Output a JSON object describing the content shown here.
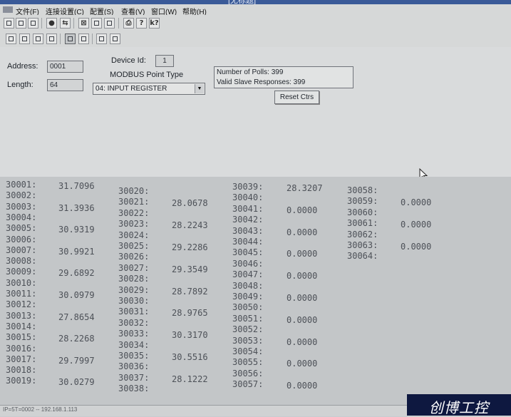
{
  "title": "[无标题]",
  "menu": [
    "文件(F)",
    "连接设置(C)",
    "配置(S)",
    "查看(V)",
    "窗口(W)",
    "帮助(H)"
  ],
  "form": {
    "address_label": "Address:",
    "address_value": "0001",
    "length_label": "Length:",
    "length_value": "64",
    "device_id_label": "Device Id:",
    "device_id_value": "1",
    "point_type_label": "MODBUS Point Type",
    "point_type_value": "04: INPUT REGISTER"
  },
  "stats": {
    "polls": "Number of Polls: 399",
    "responses": "Valid Slave Responses: 399"
  },
  "reset_button": "Reset Ctrs",
  "registers": [
    {
      "col": [
        [
          "30001:",
          "31.7096"
        ],
        [
          "30002:",
          ""
        ],
        [
          "30003:",
          "31.3936"
        ],
        [
          "30004:",
          ""
        ],
        [
          "30005:",
          "30.9319"
        ],
        [
          "30006:",
          ""
        ],
        [
          "30007:",
          "30.9921"
        ],
        [
          "30008:",
          ""
        ],
        [
          "30009:",
          "29.6892"
        ],
        [
          "30010:",
          ""
        ],
        [
          "30011:",
          "30.0979"
        ],
        [
          "30012:",
          ""
        ],
        [
          "30013:",
          "27.8654"
        ],
        [
          "30014:",
          ""
        ],
        [
          "30015:",
          "28.2268"
        ],
        [
          "30016:",
          ""
        ],
        [
          "30017:",
          "29.7997"
        ],
        [
          "30018:",
          ""
        ],
        [
          "30019:",
          "30.0279"
        ]
      ]
    },
    {
      "col": [
        [
          "30020:",
          ""
        ],
        [
          "30021:",
          "28.0678"
        ],
        [
          "30022:",
          ""
        ],
        [
          "30023:",
          "28.2243"
        ],
        [
          "30024:",
          ""
        ],
        [
          "30025:",
          "29.2286"
        ],
        [
          "30026:",
          ""
        ],
        [
          "30027:",
          "29.3549"
        ],
        [
          "30028:",
          ""
        ],
        [
          "30029:",
          "28.7892"
        ],
        [
          "30030:",
          ""
        ],
        [
          "30031:",
          "28.9765"
        ],
        [
          "30032:",
          ""
        ],
        [
          "30033:",
          "30.3170"
        ],
        [
          "30034:",
          ""
        ],
        [
          "30035:",
          "30.5516"
        ],
        [
          "30036:",
          ""
        ],
        [
          "30037:",
          "28.1222"
        ],
        [
          "30038:",
          ""
        ]
      ]
    },
    {
      "col": [
        [
          "30039:",
          "28.3207"
        ],
        [
          "30040:",
          ""
        ],
        [
          "30041:",
          "0.0000"
        ],
        [
          "30042:",
          ""
        ],
        [
          "30043:",
          "0.0000"
        ],
        [
          "30044:",
          ""
        ],
        [
          "30045:",
          "0.0000"
        ],
        [
          "30046:",
          ""
        ],
        [
          "30047:",
          "0.0000"
        ],
        [
          "30048:",
          ""
        ],
        [
          "30049:",
          "0.0000"
        ],
        [
          "30050:",
          ""
        ],
        [
          "30051:",
          "0.0000"
        ],
        [
          "30052:",
          ""
        ],
        [
          "30053:",
          "0.0000"
        ],
        [
          "30054:",
          ""
        ],
        [
          "30055:",
          "0.0000"
        ],
        [
          "30056:",
          ""
        ],
        [
          "30057:",
          "0.0000"
        ]
      ]
    },
    {
      "col": [
        [
          "30058:",
          ""
        ],
        [
          "30059:",
          "0.0000"
        ],
        [
          "30060:",
          ""
        ],
        [
          "30061:",
          "0.0000"
        ],
        [
          "30062:",
          ""
        ],
        [
          "30063:",
          "0.0000"
        ],
        [
          "30064:",
          ""
        ]
      ]
    }
  ],
  "status_text": "IP=5T=0002 -- 192.168.1.113",
  "watermark": "创博工控"
}
